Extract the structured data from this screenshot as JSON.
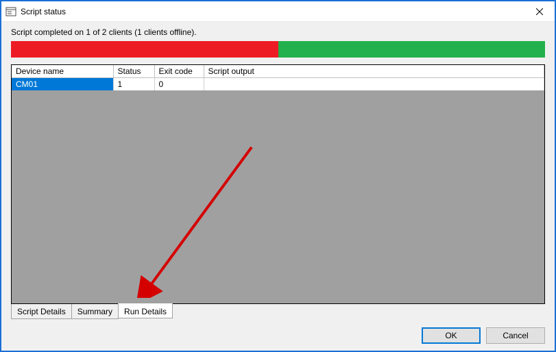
{
  "window": {
    "title": "Script status"
  },
  "status_text": "Script completed on 1 of 2 clients (1 clients offline).",
  "progress": {
    "red_pct": 50,
    "green_pct": 50
  },
  "grid": {
    "headers": {
      "device": "Device name",
      "status": "Status",
      "exit": "Exit code",
      "output": "Script output"
    },
    "rows": [
      {
        "device": "CM01",
        "status": "1",
        "exit": "0",
        "output": ""
      }
    ]
  },
  "tabs": {
    "items": [
      {
        "label": "Script Details",
        "active": false
      },
      {
        "label": "Summary",
        "active": false
      },
      {
        "label": "Run Details",
        "active": true
      }
    ]
  },
  "buttons": {
    "ok": "OK",
    "cancel": "Cancel"
  },
  "colors": {
    "accent": "#0078d7",
    "progress_red": "#ed1c24",
    "progress_green": "#22b14c"
  }
}
